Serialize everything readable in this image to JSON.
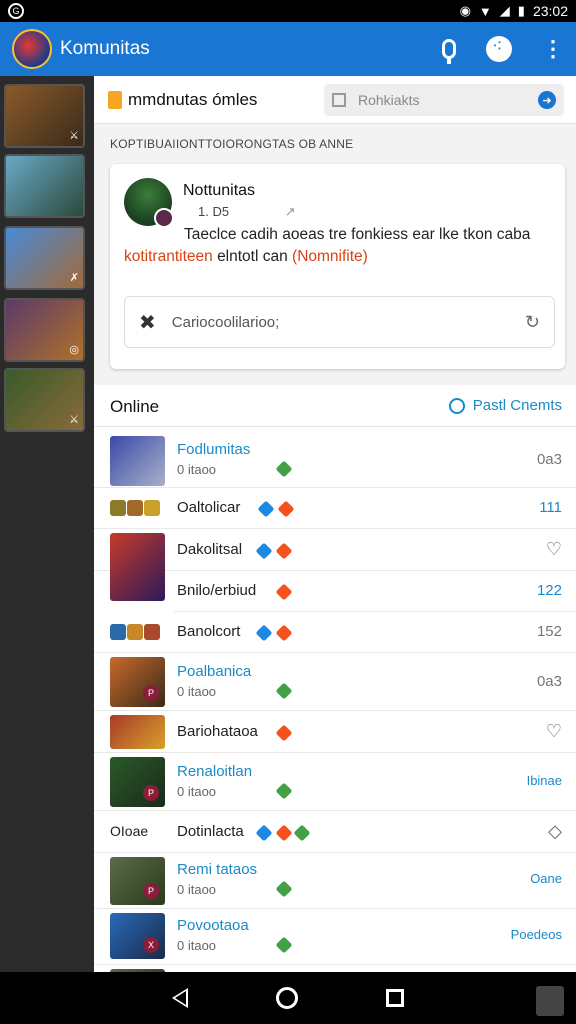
{
  "status_bar": {
    "time": "23:02"
  },
  "app_bar": {
    "title": "Komunitas"
  },
  "sub_header": {
    "title": "mmdnutas ómles",
    "search_placeholder": "Rohkiakts"
  },
  "section_label": "KOPTIBUAIIONTTOIORONGTAS OB ANNE",
  "post_card": {
    "author": "Nottunitas",
    "meta": "1. D5",
    "body_text": "Taeclce cadih aoeas tre fonkiess ear lke tkon caba",
    "body_link": "kotitrantiteen",
    "body_mid": "elntotl can",
    "body_highlight": "(Nomnifite)",
    "comment_placeholder": "Cariocoolilarioo;"
  },
  "list": {
    "title": "Online",
    "link_label": "Pastl Cnemts",
    "rows": [
      {
        "name": "Fodlumitas",
        "sub": "0 itaoo",
        "value": "0a3"
      },
      {
        "name": "Oaltolicar",
        "sub": "",
        "value": "111"
      },
      {
        "name": "Dakolitsal",
        "sub": "",
        "value": ""
      },
      {
        "name": "Bnilo/erbiud",
        "sub": "",
        "value": "122"
      },
      {
        "name": "Banolcort",
        "sub": "",
        "value": "152"
      },
      {
        "name": "Poalbanica",
        "sub": "0 itaoo",
        "value": "0a3"
      },
      {
        "name": "Bariohataoa",
        "sub": "",
        "value": ""
      },
      {
        "name": "Renaloitlan",
        "sub": "0 itaoo",
        "value": "Ibinae"
      },
      {
        "name": "Dotinlacta",
        "sub": "",
        "value": ""
      },
      {
        "name": "Remi tataos",
        "sub": "0 itaoo",
        "value": "Oane"
      },
      {
        "name": "Povootaoa",
        "sub": "0 itaoo",
        "value": "Poedeos"
      }
    ],
    "coins_text": "OIoae"
  },
  "colors": {
    "primary": "#1976d2",
    "link": "#1a8ac8",
    "highlight": "#d84315",
    "online_green": "#43a047",
    "badge_orange": "#f4511e"
  }
}
